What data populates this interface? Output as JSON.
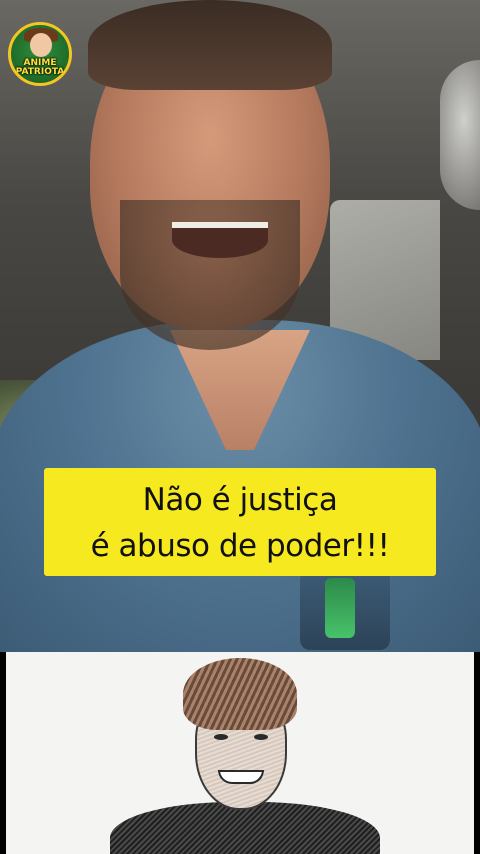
{
  "overlay": {
    "logo_text_1": "ANIME",
    "logo_text_2": "PATRIOTA",
    "caption_line_1": "Não é justiça",
    "caption_line_2": "é abuso de poder!!!"
  },
  "colors": {
    "caption_background": "#f7e91f",
    "caption_text": "#111111",
    "logo_ring": "#f3c623",
    "logo_text": "#ffe23a"
  }
}
